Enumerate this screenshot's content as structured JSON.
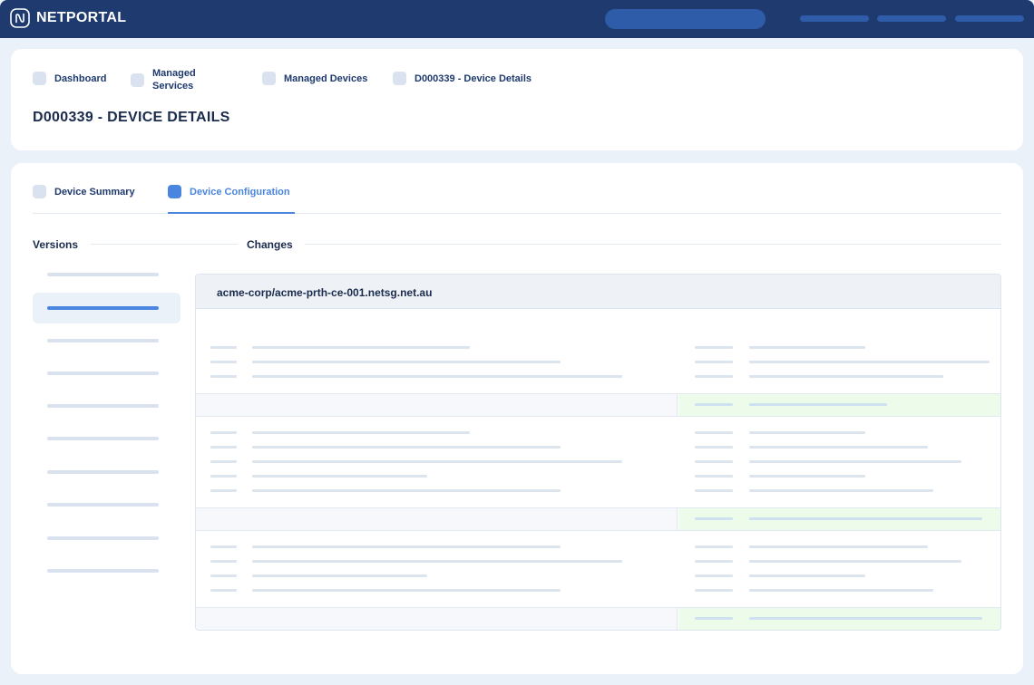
{
  "app": {
    "name": "NETPORTAL"
  },
  "breadcrumbs": [
    {
      "label": "Dashboard"
    },
    {
      "label": "Managed Services"
    },
    {
      "label": "Managed Devices"
    },
    {
      "label": "D000339 - Device Details"
    }
  ],
  "page_title": "D000339 - DEVICE DETAILS",
  "tabs": [
    {
      "label": "Device Summary",
      "active": false
    },
    {
      "label": "Device Configuration",
      "active": true
    }
  ],
  "sections": {
    "versions": "Versions",
    "changes": "Changes"
  },
  "changes": {
    "file_name": "acme-corp/acme-prth-ce-001.netsg.net.au"
  },
  "colors": {
    "brand": "#1e3a6e",
    "accent": "#4a86e0",
    "added_bg": "#ecfbea",
    "page_bg": "#ebf1f8"
  }
}
